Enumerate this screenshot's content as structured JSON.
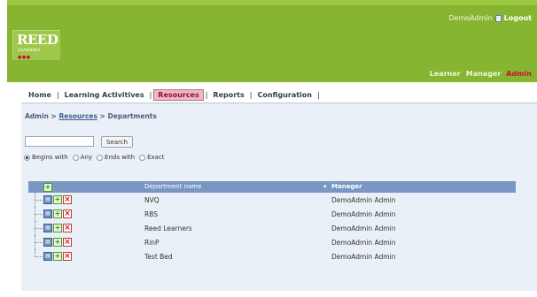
{
  "header": {
    "logo_title": "REED",
    "logo_subtitle": "LEARNING",
    "logo_dots": "●●●",
    "username": "DemoAdmin",
    "logout_label": "Logout",
    "roles": [
      "Learner",
      "Manager",
      "Admin"
    ],
    "active_role": "Admin",
    "brand_color": "#86b532",
    "accent_color": "#c8102e"
  },
  "nav": {
    "items": [
      "Home",
      "Learning Activitives",
      "Resources",
      "Reports",
      "Configuration"
    ],
    "active": "Resources"
  },
  "breadcrumb": {
    "root": "Admin",
    "link": "Resources",
    "current": "Departments",
    "separator": ">"
  },
  "search": {
    "value": "",
    "button_label": "Search",
    "options": [
      "Begins with",
      "Any",
      "Ends with",
      "Exact"
    ],
    "selected": "Begins with"
  },
  "grid": {
    "columns": [
      "Department name",
      "Manager"
    ],
    "sorted_column": "Manager",
    "sort_glyph": "▴",
    "rows": [
      {
        "department": "NVQ",
        "manager": "DemoAdmin Admin"
      },
      {
        "department": "RBS",
        "manager": "DemoAdmin Admin"
      },
      {
        "department": "Reed Learners",
        "manager": "DemoAdmin Admin"
      },
      {
        "department": "RinP",
        "manager": "DemoAdmin Admin"
      },
      {
        "department": "Test Bed",
        "manager": "DemoAdmin Admin"
      }
    ],
    "header_color": "#7a97c3"
  }
}
